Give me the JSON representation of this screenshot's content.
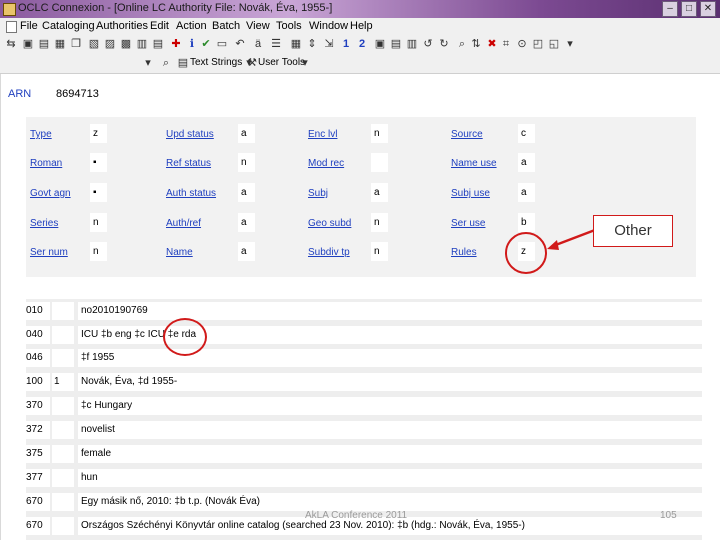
{
  "window": {
    "title": "OCLC Connexion - [Online LC Authority File: Novák, Éva, 1955-]"
  },
  "menu": [
    "File",
    "Cataloging",
    "Authorities",
    "Edit",
    "Action",
    "Batch",
    "View",
    "Tools",
    "Window",
    "Help"
  ],
  "toolbar": {
    "row1_numbers": [
      "1",
      "2"
    ],
    "text_strings": "Text Strings",
    "user_tools": "User Tools"
  },
  "record": {
    "arn_label": "ARN",
    "arn_value": "8694713",
    "fixed_fields": [
      {
        "label": "Type",
        "value": "z"
      },
      {
        "label": "Upd status",
        "value": "a"
      },
      {
        "label": "Enc lvl",
        "value": "n"
      },
      {
        "label": "Source",
        "value": "c"
      },
      {
        "label": "Roman",
        "value": "▪"
      },
      {
        "label": "Ref status",
        "value": "n"
      },
      {
        "label": "Mod rec",
        "value": ""
      },
      {
        "label": "Name use",
        "value": "a"
      },
      {
        "label": "Govt agn",
        "value": "▪"
      },
      {
        "label": "Auth status",
        "value": "a"
      },
      {
        "label": "Subj",
        "value": "a"
      },
      {
        "label": "Subj use",
        "value": "a"
      },
      {
        "label": "Series",
        "value": "n"
      },
      {
        "label": "Auth/ref",
        "value": "a"
      },
      {
        "label": "Geo subd",
        "value": "n"
      },
      {
        "label": "Ser use",
        "value": "b"
      },
      {
        "label": "Ser num",
        "value": "n"
      },
      {
        "label": "Name",
        "value": "a"
      },
      {
        "label": "Subdiv tp",
        "value": "n"
      },
      {
        "label": "Rules",
        "value": "z"
      }
    ],
    "variable_fields": [
      {
        "tag": "010",
        "ind": "",
        "value": "no2010190769"
      },
      {
        "tag": "040",
        "ind": "",
        "value": "ICU ‡b eng ‡c ICU ‡e rda"
      },
      {
        "tag": "046",
        "ind": "",
        "value": "‡f 1955"
      },
      {
        "tag": "100",
        "ind": "1",
        "value": "Novák, Éva, ‡d 1955-"
      },
      {
        "tag": "370",
        "ind": "",
        "value": "‡c Hungary"
      },
      {
        "tag": "372",
        "ind": "",
        "value": "novelist"
      },
      {
        "tag": "375",
        "ind": "",
        "value": "female"
      },
      {
        "tag": "377",
        "ind": "",
        "value": "hun"
      },
      {
        "tag": "670",
        "ind": "",
        "value": "Egy másik nő, 2010: ‡b t.p. (Novák Éva)"
      },
      {
        "tag": "670",
        "ind": "",
        "value": "Országos Széchényi Könyvtár online catalog (searched 23 Nov. 2010): ‡b (hdg.: Novák, Éva, 1955-)"
      }
    ]
  },
  "annotation": {
    "callout_text": "Other",
    "color": "#d11a1a"
  },
  "footer": {
    "conference": "AkLA Conference 2011",
    "slide_number": "105"
  }
}
